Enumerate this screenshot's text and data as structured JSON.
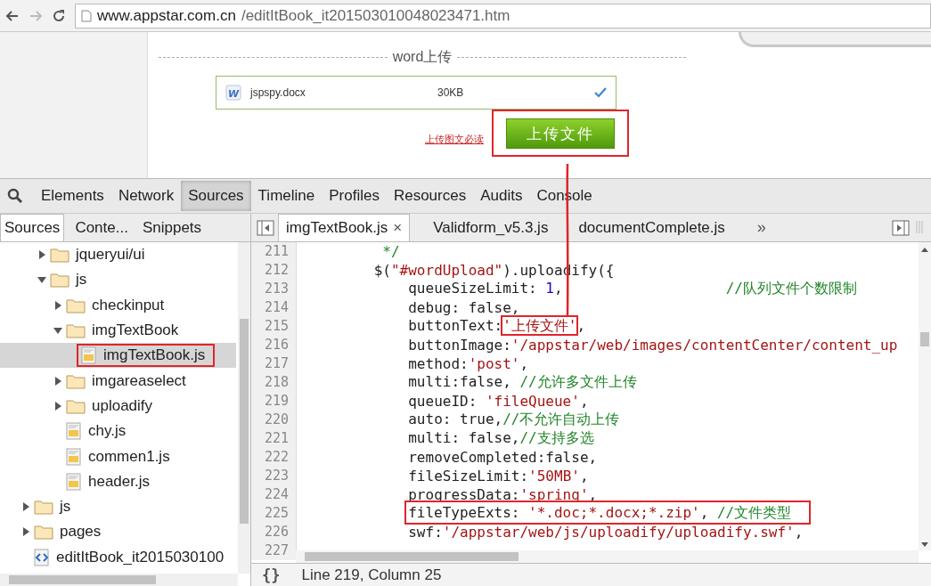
{
  "browser": {
    "url_host": "www.appstar.com.cn",
    "url_path": "/editItBook_it201503010048023471.htm"
  },
  "page": {
    "section_title": "word上传",
    "file": {
      "icon_text": "W",
      "name": "jspspy.docx",
      "size": "30KB",
      "done": true
    },
    "guide_link": "上传图文必读",
    "upload_button": {
      "label": "上传文件",
      "annotated": true
    }
  },
  "devtools": {
    "tabs": [
      {
        "label": "Elements",
        "selected": false
      },
      {
        "label": "Network",
        "selected": false
      },
      {
        "label": "Sources",
        "selected": true
      },
      {
        "label": "Timeline",
        "selected": false
      },
      {
        "label": "Profiles",
        "selected": false
      },
      {
        "label": "Resources",
        "selected": false
      },
      {
        "label": "Audits",
        "selected": false
      },
      {
        "label": "Console",
        "selected": false
      }
    ],
    "navigator_tabs": [
      {
        "label": "Sources",
        "selected": true
      },
      {
        "label": "Conte...",
        "selected": false
      },
      {
        "label": "Snippets",
        "selected": false
      }
    ],
    "tree": [
      {
        "children": [
          {
            "label": "jqueryui/ui",
            "kind": "folder",
            "expanded": false
          },
          {
            "label": "js",
            "kind": "folder",
            "expanded": true,
            "children": [
              {
                "label": "checkinput",
                "kind": "folder",
                "expanded": false
              },
              {
                "label": "imgTextBook",
                "kind": "folder",
                "expanded": true,
                "children": [
                  {
                    "label": "imgTextBook.js",
                    "kind": "script",
                    "selected": true,
                    "annotated": true
                  }
                ]
              },
              {
                "label": "imgareaselect",
                "kind": "folder",
                "expanded": false
              },
              {
                "label": "uploadify",
                "kind": "folder",
                "expanded": false
              },
              {
                "label": "chy.js",
                "kind": "script",
                "selected": false
              },
              {
                "label": "commen1.js",
                "kind": "script",
                "selected": false
              },
              {
                "label": "header.js",
                "kind": "script",
                "selected": false
              }
            ]
          }
        ]
      },
      {
        "label": "js",
        "kind": "folder",
        "expanded": false
      },
      {
        "label": "pages",
        "kind": "folder",
        "expanded": false
      },
      {
        "label": "editItBook_it2015030100",
        "kind": "html",
        "selected": false
      }
    ],
    "editor_tabs": [
      {
        "label": "imgTextBook.js",
        "selected": true,
        "close": "×"
      },
      {
        "label": "Validform_v5.3.js",
        "selected": false
      },
      {
        "label": "documentComplete.js",
        "selected": false
      }
    ],
    "more_tabs": "»",
    "code": [
      {
        "number": "211",
        "tokens": [
          {
            "kind": "comment",
            "text": "          */"
          }
        ]
      },
      {
        "number": "212",
        "tokens": [
          {
            "kind": "plain",
            "text": "         $("
          },
          {
            "kind": "string",
            "text": "\"#wordUpload\""
          },
          {
            "kind": "plain",
            "text": ").uploadify({"
          }
        ]
      },
      {
        "number": "213",
        "tokens": [
          {
            "kind": "plain",
            "text": "             queueSizeLimit: "
          },
          {
            "kind": "number",
            "text": "1"
          },
          {
            "kind": "plain",
            "text": ",                   "
          },
          {
            "kind": "comment",
            "text": "//队列文件个数限制"
          }
        ]
      },
      {
        "number": "214",
        "tokens": [
          {
            "kind": "plain",
            "text": "             debug: false,"
          }
        ]
      },
      {
        "number": "215",
        "tokens": [
          {
            "kind": "plain",
            "text": "             buttonText:"
          },
          {
            "kind": "string",
            "text": "'上传文件'",
            "annotated": true
          },
          {
            "kind": "plain",
            "text": ","
          }
        ]
      },
      {
        "number": "216",
        "tokens": [
          {
            "kind": "plain",
            "text": "             buttonImage:"
          },
          {
            "kind": "string",
            "text": "'/appstar/web/images/contentCenter/content_up"
          }
        ]
      },
      {
        "number": "217",
        "tokens": [
          {
            "kind": "plain",
            "text": "             method:"
          },
          {
            "kind": "string",
            "text": "'post'"
          },
          {
            "kind": "plain",
            "text": ","
          }
        ]
      },
      {
        "number": "218",
        "tokens": [
          {
            "kind": "plain",
            "text": "             multi:false, "
          },
          {
            "kind": "comment",
            "text": "//允许多文件上传"
          }
        ]
      },
      {
        "number": "219",
        "tokens": [
          {
            "kind": "plain",
            "text": "             queueID: "
          },
          {
            "kind": "string",
            "text": "'fileQueue'"
          },
          {
            "kind": "plain",
            "text": ","
          }
        ]
      },
      {
        "number": "220",
        "tokens": [
          {
            "kind": "plain",
            "text": "             auto: true,"
          },
          {
            "kind": "comment",
            "text": "//不允许自动上传"
          }
        ]
      },
      {
        "number": "221",
        "tokens": [
          {
            "kind": "plain",
            "text": "             multi: false,"
          },
          {
            "kind": "comment",
            "text": "//支持多选"
          }
        ]
      },
      {
        "number": "222",
        "tokens": [
          {
            "kind": "plain",
            "text": "             removeCompleted:false,"
          }
        ]
      },
      {
        "number": "223",
        "tokens": [
          {
            "kind": "plain",
            "text": "             fileSizeLimit:"
          },
          {
            "kind": "string",
            "text": "'50MB'"
          },
          {
            "kind": "plain",
            "text": ","
          }
        ]
      },
      {
        "number": "224",
        "tokens": [
          {
            "kind": "plain",
            "text": "             progressData:"
          },
          {
            "kind": "string",
            "text": "'spring'"
          },
          {
            "kind": "plain",
            "text": ","
          }
        ]
      },
      {
        "number": "225",
        "annotated": true,
        "tokens": [
          {
            "kind": "plain",
            "text": "fileTypeExts: "
          },
          {
            "kind": "string",
            "text": "'*.doc;*.docx;*.zip'"
          },
          {
            "kind": "plain",
            "text": ", "
          },
          {
            "kind": "comment",
            "text": "//文件类型"
          }
        ]
      },
      {
        "number": "226",
        "tokens": [
          {
            "kind": "plain",
            "text": "             swf:"
          },
          {
            "kind": "string",
            "text": "'/appstar/web/js/uploadify/uploadify.swf'"
          },
          {
            "kind": "plain",
            "text": ","
          }
        ]
      },
      {
        "number": "227"
      }
    ],
    "status": {
      "format_button": "{}",
      "position": "Line 219, Column 25"
    }
  }
}
